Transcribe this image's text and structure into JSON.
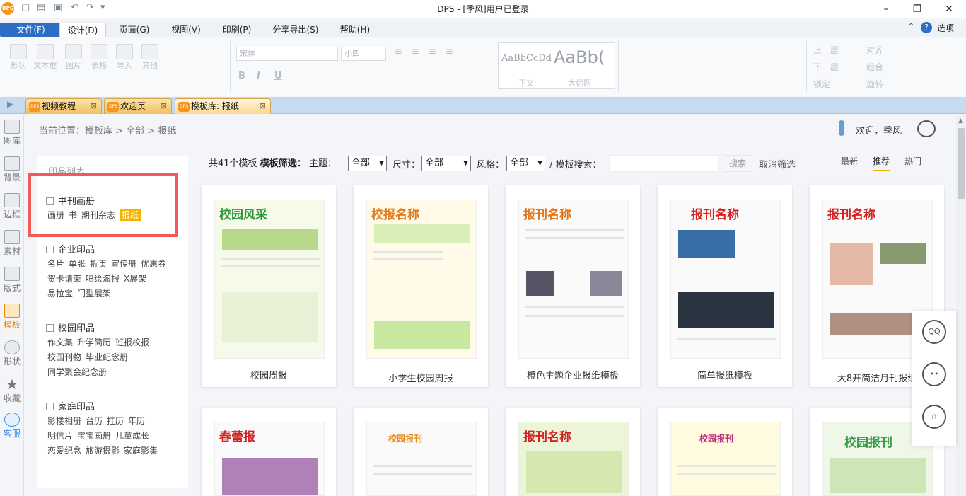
{
  "window": {
    "title": "DPS - [季风]用户已登录",
    "logo_text": "DPS"
  },
  "menu": {
    "items": [
      "文件(F)",
      "设计(D)",
      "页面(G)",
      "视图(V)",
      "印刷(P)",
      "分享导出(S)",
      "帮助(H)"
    ],
    "options_label": "选项"
  },
  "ribbon": {
    "insert_labels": [
      "形状",
      "文本框",
      "图片",
      "表格",
      "导入",
      "其他"
    ],
    "font_name": "宋体",
    "font_size": "小四",
    "styles": [
      "AaBbCcDd",
      "AaBb(",
      "正文",
      "大标题"
    ],
    "arrange_labels": [
      "上一层",
      "下一层",
      "锁定",
      "对齐",
      "组合",
      "旋转"
    ],
    "format_buttons": [
      "B",
      "I",
      "U"
    ]
  },
  "tabs": [
    {
      "label": "视频教程"
    },
    {
      "label": "欢迎页"
    },
    {
      "label": "模板库: 报纸"
    }
  ],
  "leftbar": [
    "图库",
    "背景",
    "边框",
    "素材",
    "版式",
    "模板",
    "形状",
    "收藏",
    "客服"
  ],
  "breadcrumb": "当前位置：模板库 > 全部 > 报纸",
  "welcome": "欢迎，季风",
  "category_panel": {
    "title": "印品列表",
    "groups": [
      {
        "name": "书刊画册",
        "items": [
          "画册",
          "书",
          "期刊杂志",
          "报纸"
        ]
      },
      {
        "name": "企业印品",
        "items": [
          "名片",
          "单张",
          "折页",
          "宣传册",
          "优惠券",
          "贺卡请柬",
          "喷绘海报",
          "X展架",
          "易拉宝",
          "门型展架"
        ]
      },
      {
        "name": "校园印品",
        "items": [
          "作文集",
          "升学简历",
          "班报校报",
          "校园刊物",
          "毕业纪念册",
          "同学聚会纪念册"
        ]
      },
      {
        "name": "家庭印品",
        "items": [
          "影楼相册",
          "台历",
          "挂历",
          "年历",
          "明信片",
          "宝宝画册",
          "儿童成长",
          "恋爱纪念",
          "旅游摄影",
          "家庭影集"
        ]
      }
    ]
  },
  "filter": {
    "count": "共41个模板",
    "filter_label": "模板筛选：",
    "theme_label": "主题：",
    "theme_value": "全部",
    "size_label": "尺寸：",
    "size_value": "全部",
    "style_label": "风格：",
    "style_value": "全部",
    "search_label": "/ 模板搜索：",
    "search_button": "搜索",
    "cancel": "取消筛选",
    "sort": [
      "最新",
      "推荐",
      "热门"
    ]
  },
  "templates": [
    {
      "name": "校园周报",
      "headline": "校园风采",
      "color": "#2b9a3a"
    },
    {
      "name": "小学生校园周报",
      "headline": "校报名称",
      "color": "#e37b1c"
    },
    {
      "name": "橙色主题企业报纸模板",
      "headline": "报刊名称",
      "color": "#e0761b"
    },
    {
      "name": "简单报纸模板",
      "headline": "报刊名称",
      "color": "#d32222"
    },
    {
      "name": "大8开简洁月刊报纸",
      "headline": "报刊名称",
      "color": "#d32222"
    },
    {
      "name": "",
      "headline": "春蕾报",
      "color": "#d32222"
    },
    {
      "name": "",
      "headline": "校园报刊",
      "color": "#e58c20"
    },
    {
      "name": "",
      "headline": "报刊名称",
      "color": "#d32222"
    },
    {
      "name": "",
      "headline": "校园报刊",
      "color": "#c02c7a"
    },
    {
      "name": "",
      "headline": "校园报刊",
      "color": "#3a9a4a"
    }
  ]
}
